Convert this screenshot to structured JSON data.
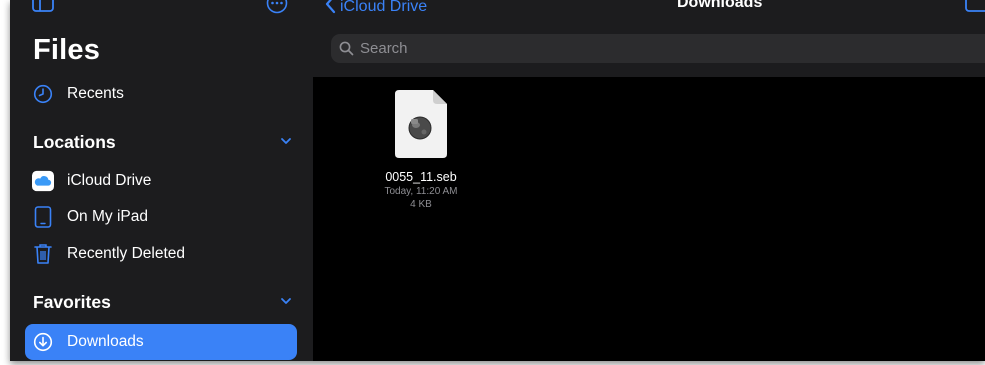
{
  "sidebar": {
    "title": "Files",
    "recents_label": "Recents",
    "locations": {
      "header": "Locations",
      "items": [
        {
          "label": "iCloud Drive",
          "icon": "icloud-icon"
        },
        {
          "label": "On My iPad",
          "icon": "ipad-icon"
        },
        {
          "label": "Recently Deleted",
          "icon": "trash-icon"
        }
      ]
    },
    "favorites": {
      "header": "Favorites",
      "items": [
        {
          "label": "Downloads",
          "icon": "download-icon",
          "selected": true
        }
      ]
    }
  },
  "nav": {
    "back_label": "iCloud Drive",
    "title": "Downloads"
  },
  "search": {
    "placeholder": "Search"
  },
  "files": [
    {
      "name": "0055_11.seb",
      "date": "Today, 11:20 AM",
      "size": "4 KB",
      "icon": "seb-document-icon"
    }
  ],
  "colors": {
    "accent": "#3a82f7",
    "sidebar_bg": "#1c1c1e",
    "content_bg": "#000000",
    "secondary_text": "#8e8e93"
  }
}
